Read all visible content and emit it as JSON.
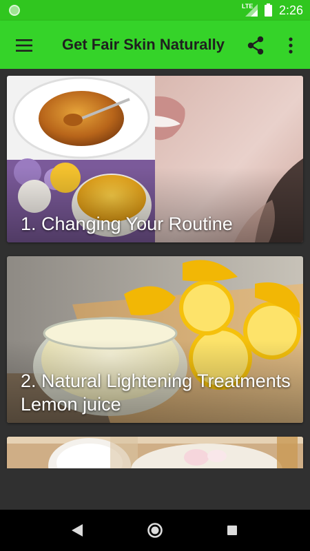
{
  "status_bar": {
    "network": "LTE",
    "time": "2:26",
    "notification_icon": "app-notification-icon",
    "signal_icon": "cell-signal-icon",
    "battery_icon": "battery-icon"
  },
  "toolbar": {
    "title": "Get Fair Skin Naturally",
    "menu_icon": "menu-icon",
    "share_icon": "share-icon",
    "more_icon": "more-vert-icon"
  },
  "articles": [
    {
      "title": "1. Changing Your Routine"
    },
    {
      "title": "2. Natural Lightening Treatments Lemon juice"
    },
    {
      "title": ""
    }
  ],
  "nav_bar": {
    "back_icon": "back-icon",
    "home_icon": "home-icon",
    "recents_icon": "recents-icon"
  },
  "colors": {
    "status_bar": "#30c61f",
    "toolbar": "#35d329",
    "background": "#303030",
    "nav_bar": "#000000"
  }
}
